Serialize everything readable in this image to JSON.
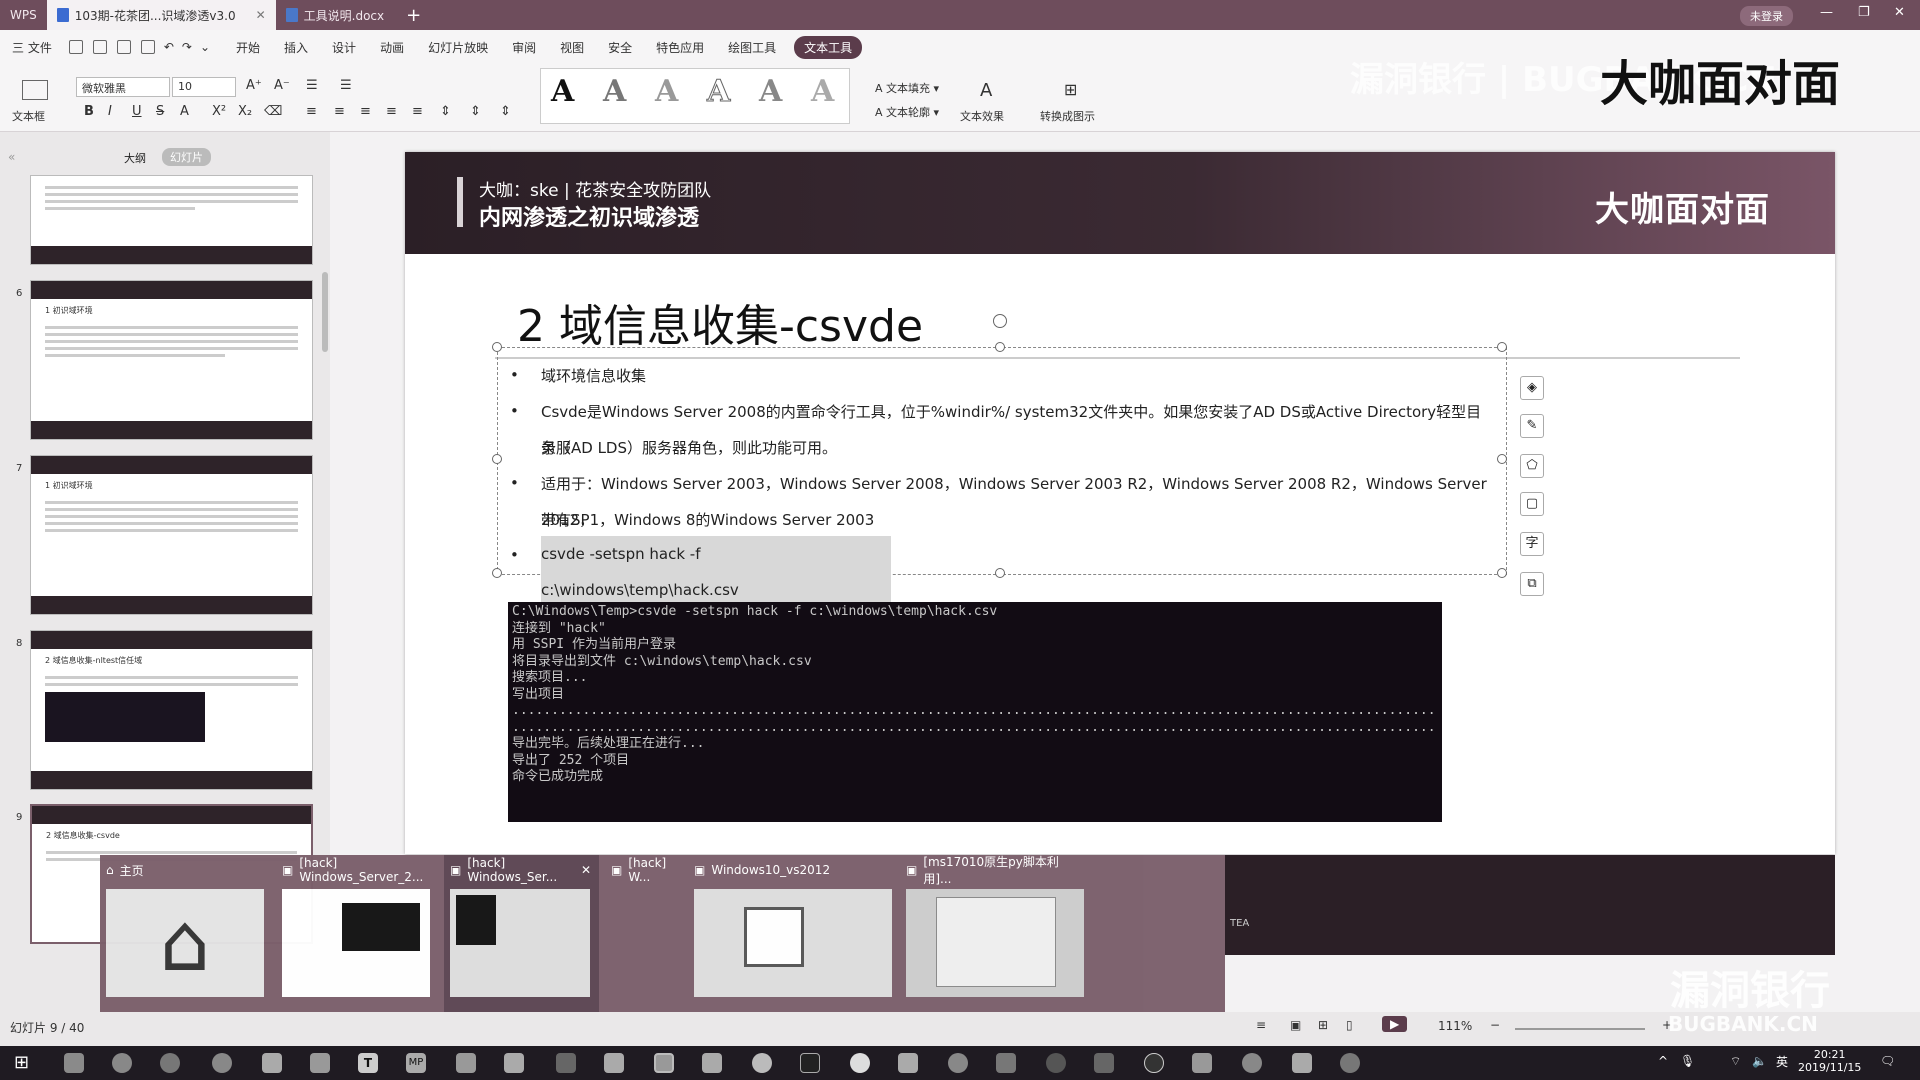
{
  "titlebar": {
    "app": "WPS",
    "tabs": [
      {
        "label": "103期-花茶团...识域渗透v3.0"
      },
      {
        "label": "工具说明.docx"
      }
    ],
    "login": "未登录"
  },
  "menu": {
    "items": [
      "三 文件",
      "开始",
      "插入",
      "设计",
      "动画",
      "幻灯片放映",
      "审阅",
      "视图",
      "安全",
      "特色应用",
      "绘图工具"
    ],
    "active": "文本工具"
  },
  "ribbon": {
    "textbox": "文本框",
    "font": "微软雅黑",
    "size": "10",
    "fill": "文本填充",
    "outline": "文本轮廓",
    "effect": "文本效果",
    "convert": "转换成图示",
    "styles": [
      "A",
      "A",
      "A",
      "A",
      "A",
      "A"
    ]
  },
  "leftpanel": {
    "tabs": [
      "大纲",
      "幻灯片"
    ],
    "thumbs": [
      {
        "num": "",
        "title": ""
      },
      {
        "num": "6",
        "title": "1 初识域环境"
      },
      {
        "num": "7",
        "title": "1 初识域环境"
      },
      {
        "num": "8",
        "title": "2 域信息收集-nltest信任域"
      },
      {
        "num": "9",
        "title": "2 域信息收集-csvde"
      }
    ]
  },
  "slide": {
    "header_sub": "大咖：ske | 花茶安全攻防团队",
    "header_main": "内网渗透之初识域渗透",
    "header_logo": "大咖面对面",
    "title": "2 域信息收集-csvde",
    "bullets": [
      "域环境信息收集",
      "Csvde是Windows Server 2008的内置命令行工具，位于%windir%/ system32文件夹中。如果您安装了AD DS或Active Directory轻型目录服",
      "务（AD LDS）服务器角色，则此功能可用。",
      "适用于：Windows Server 2003，Windows Server 2008，Windows Server 2003 R2，Windows Server 2008 R2，Windows Server 2012，",
      "带有SP1，Windows 8的Windows Server 2003",
      "csvde -setspn hack -f c:\\windows\\temp\\hack.csv"
    ],
    "terminal": [
      "C:\\Windows\\Temp>csvde -setspn hack -f c:\\windows\\temp\\hack.csv",
      "连接到 \"hack\"",
      "用 SSPI 作为当前用户登录",
      "将目录导出到文件 c:\\windows\\temp\\hack.csv",
      "搜索项目...",
      "写出项目",
      "",
      "",
      "导出完毕。后续处理正在进行...",
      "导出了 252 个项目",
      "",
      "命令已成功完成"
    ]
  },
  "previews": [
    {
      "label": "主页"
    },
    {
      "label": "[hack] Windows_Server_2..."
    },
    {
      "label": "[hack] Windows_Ser..."
    },
    {
      "label": "[hack] W..."
    },
    {
      "label": "Windows10_vs2012"
    },
    {
      "label": "[ms17010原生py脚本利用]..."
    }
  ],
  "statusbar": {
    "slide": "幻灯片 9 / 40",
    "zoom": "111%"
  },
  "watermark": {
    "top": "漏洞银行 | BUGBANK.CN",
    "brand": "大咖面对面",
    "bottom": "漏洞银行",
    "bottom_en": "BUGBANK.CN",
    "tea": "TEA"
  },
  "clock": {
    "time": "20:21",
    "date": "2019/11/15",
    "ime": "英"
  }
}
